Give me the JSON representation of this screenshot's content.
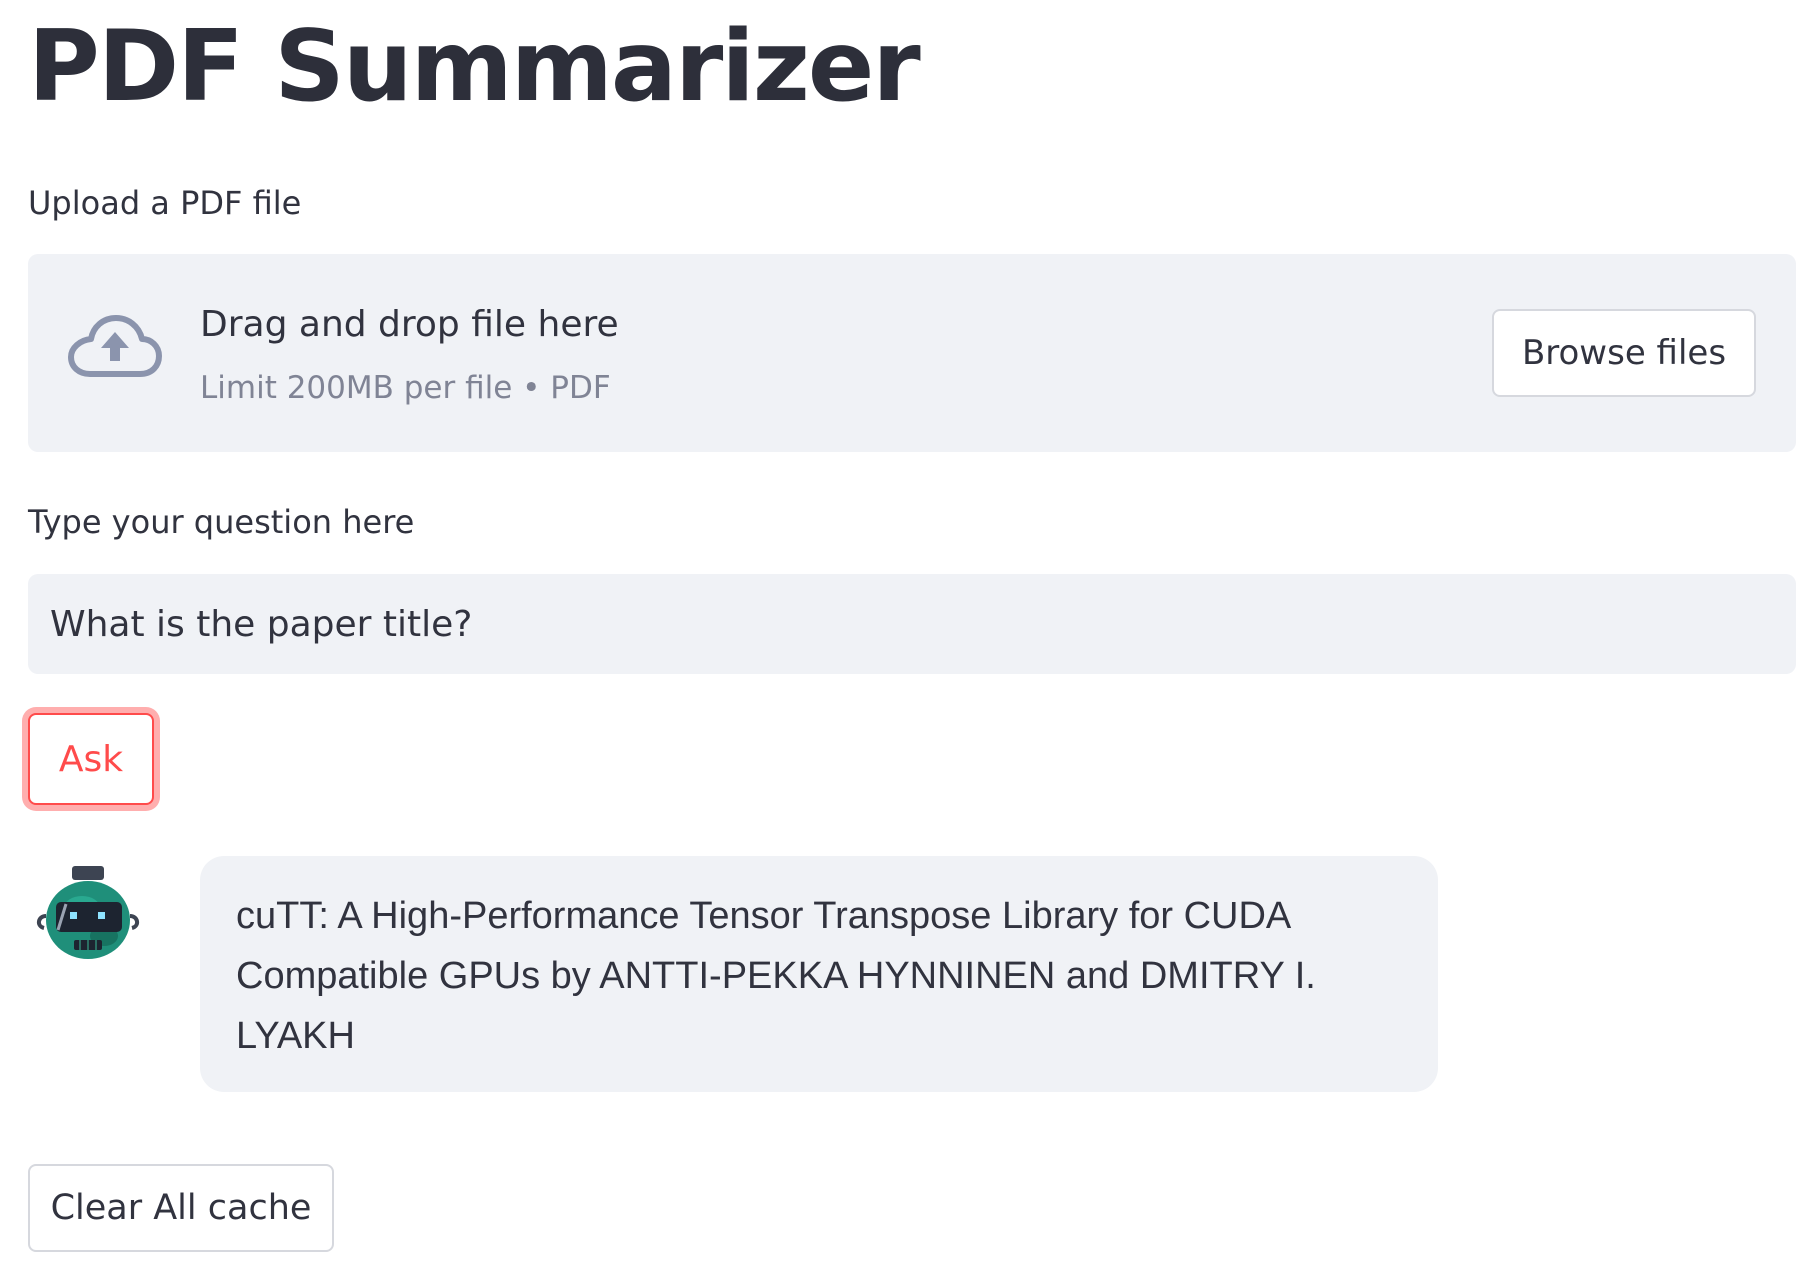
{
  "page": {
    "title": "PDF Summarizer"
  },
  "uploader": {
    "label": "Upload a PDF file",
    "drop_text": "Drag and drop file here",
    "limit_text": "Limit 200MB per file • PDF",
    "browse_label": "Browse files",
    "icon": "cloud-upload-icon"
  },
  "question": {
    "label": "Type your question here",
    "value": "What is the paper title?"
  },
  "ask_button": {
    "label": "Ask"
  },
  "chat": {
    "avatar": "robot-avatar-icon",
    "response": "cuTT: A High-Performance Tensor Transpose Library for CUDA Compatible GPUs by ANTTI-PEKKA HYNNINEN and DMITRY I. LYAKH"
  },
  "clear_button": {
    "label": "Clear All cache"
  },
  "colors": {
    "primary": "#ff4b4b",
    "text": "#31333f",
    "muted": "#808495",
    "surface": "#f0f2f6",
    "avatar_teal": "#1f8f7a"
  }
}
